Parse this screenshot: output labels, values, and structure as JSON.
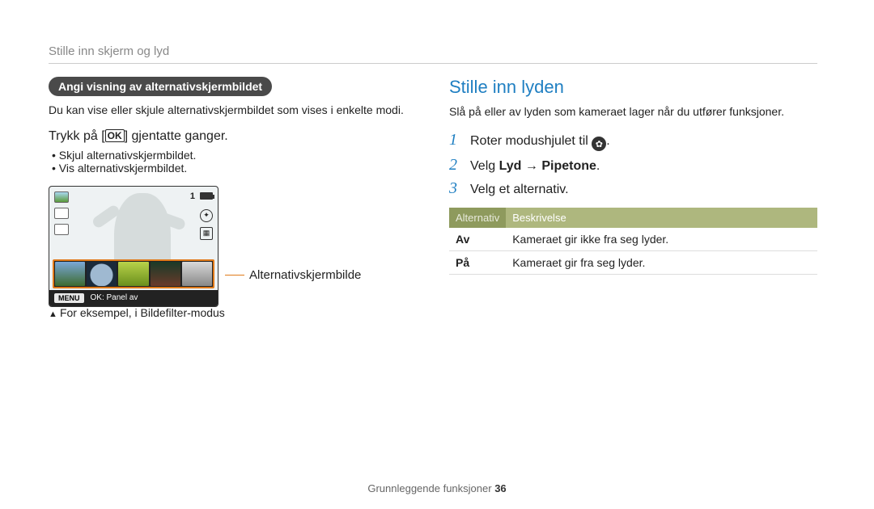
{
  "breadcrumb": "Stille inn skjerm og lyd",
  "left": {
    "pill": "Angi visning av alternativskjermbildet",
    "intro": "Du kan vise eller skjule alternativskjermbildet som vises i enkelte modi.",
    "press_pre": "Trykk på [",
    "ok": "OK",
    "press_post": "] gjentatte ganger.",
    "bul1": "Skjul alternativskjermbildet.",
    "bul2": "Vis alternativskjermbildet.",
    "menu_chip": "MENU",
    "ok_panel": "OK: Panel av",
    "screen_num": "1",
    "callout": "Alternativskjermbilde",
    "caption": "For eksempel, i Bildefilter-modus"
  },
  "right": {
    "title": "Stille inn lyden",
    "intro": "Slå på eller av lyden som kameraet lager når du utfører funksjoner.",
    "step1_pre": "Roter modushjulet til ",
    "step1_post": ".",
    "step2_pre": "Velg ",
    "step2_b1": "Lyd",
    "step2_arrow": " → ",
    "step2_b2": "Pipetone",
    "step2_post": ".",
    "step3": "Velg et alternativ.",
    "th1": "Alternativ",
    "th2": "Beskrivelse",
    "rows": [
      {
        "k": "Av",
        "v": "Kameraet gir ikke fra seg lyder."
      },
      {
        "k": "På",
        "v": "Kameraet gir fra seg lyder."
      }
    ]
  },
  "footer": {
    "label": "Grunnleggende funksjoner  ",
    "page": "36"
  }
}
